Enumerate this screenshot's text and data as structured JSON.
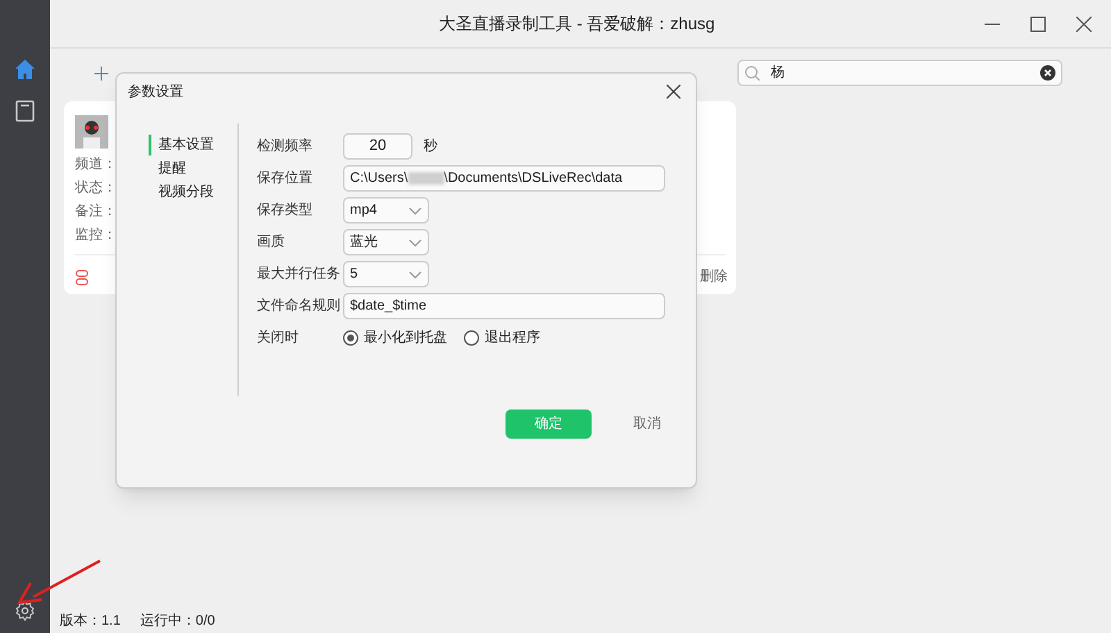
{
  "window": {
    "title": "大圣直播录制工具 - 吾爱破解：zhusg"
  },
  "sidebar": {
    "items": [
      {
        "kind": "home",
        "selected": true
      },
      {
        "kind": "book",
        "selected": false
      }
    ]
  },
  "search": {
    "value": "杨"
  },
  "card": {
    "fields": [
      "频道：",
      "状态：",
      "备注：",
      "监控："
    ],
    "delete": "删除"
  },
  "dialog": {
    "title": "参数设置",
    "nav": [
      {
        "label": "基本设置",
        "selected": true
      },
      {
        "label": "提醒",
        "selected": false
      },
      {
        "label": "视频分段",
        "selected": false
      }
    ],
    "rows": [
      {
        "kind": "number",
        "label": "检测频率",
        "value": "20",
        "unit": "秒"
      },
      {
        "kind": "path",
        "label": "保存位置",
        "value_start": "C:\\Users\\",
        "value_end": "\\Documents\\DSLiveRec\\data"
      },
      {
        "kind": "select",
        "label": "保存类型",
        "value": "mp4"
      },
      {
        "kind": "select",
        "label": "画质",
        "value": "蓝光"
      },
      {
        "kind": "select",
        "label": "最大并行任务",
        "value": "5"
      },
      {
        "kind": "text",
        "label": "文件命名规则",
        "value": "$date_$time"
      },
      {
        "kind": "radio",
        "label": "关闭时",
        "options": [
          {
            "label": "最小化到托盘",
            "selected": true
          },
          {
            "label": "退出程序",
            "selected": false
          }
        ]
      }
    ],
    "ok": "确定",
    "cancel": "取消"
  },
  "status_bar": {
    "version": "版本：1.1",
    "running": "运行中：0/0"
  }
}
